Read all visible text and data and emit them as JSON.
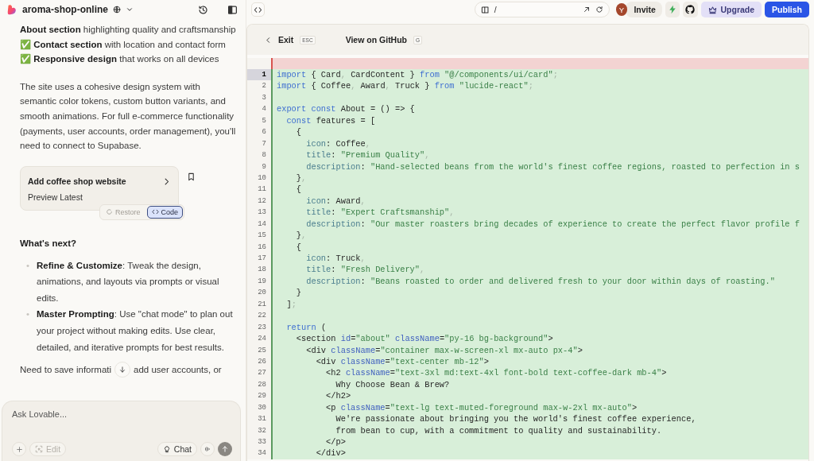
{
  "project": {
    "name": "aroma-shop-online"
  },
  "chat": {
    "paragraphs": [
      "**About section** highlighting quality and craftsmanship ✅ **Contact section** with location and contact form ✅ **Responsive design** that works on all devices",
      "The site uses a cohesive design system with semantic color tokens, custom button variants, and smooth animations. For full e-commerce functionality (payments, user accounts, order management), you'll need to connect to Supabase."
    ],
    "version_card": {
      "title": "Add coffee shop website",
      "subtitle": "Preview Latest"
    },
    "version_actions": [
      {
        "label": "Restore",
        "selected": false
      },
      {
        "label": "Code",
        "selected": true
      }
    ],
    "heading": "What's next?",
    "bullets": [
      {
        "marker": "•",
        "text": "**Refine & Customize**: Tweak the design, animations, and layouts via prompts or visual edits."
      },
      {
        "marker": "•",
        "text": "**Master Prompting**: Use \"chat mode\" to plan out your project without making edits. Use clear, detailed, and iterative prompts for best results."
      }
    ],
    "tail": [
      "Need to save informati",
      "add user accounts, or"
    ]
  },
  "composer": {
    "placeholder": "Ask Lovable...",
    "edit": {
      "label": "Edit",
      "disabled": true
    },
    "mode_label": "Chat"
  },
  "preview_bar": {
    "path": "/",
    "avatar": "Y",
    "invite": "Invite",
    "upgrade": "Upgrade",
    "publish": "Publish"
  },
  "code_view": {
    "exit": "Exit",
    "exit_key": "ESC",
    "github": "View on GitHub",
    "github_key": "G",
    "lines": [
      {
        "kind": "removed",
        "selected": false
      },
      {
        "kind": "added",
        "number": "1",
        "selected": true,
        "tokens": [
          {
            "kind": "kw",
            "text": "import"
          },
          {
            "kind": "id",
            "text": " { Card"
          },
          {
            "kind": "p",
            "text": ","
          },
          {
            "kind": "id",
            "text": " CardContent } "
          },
          {
            "kind": "kw",
            "text": "from"
          },
          {
            "kind": "str",
            "text": " \"@/components/ui/card\""
          },
          {
            "kind": "p",
            "text": ";"
          }
        ]
      },
      {
        "kind": "added",
        "number": "2",
        "selected": false,
        "tokens": [
          {
            "kind": "kw",
            "text": "import"
          },
          {
            "kind": "id",
            "text": " { Coffee"
          },
          {
            "kind": "p",
            "text": ","
          },
          {
            "kind": "id",
            "text": " Award"
          },
          {
            "kind": "p",
            "text": ","
          },
          {
            "kind": "id",
            "text": " Truck } "
          },
          {
            "kind": "kw",
            "text": "from"
          },
          {
            "kind": "str",
            "text": " \"lucide-react\""
          },
          {
            "kind": "p",
            "text": ";"
          }
        ]
      },
      {
        "kind": "added",
        "number": "3",
        "selected": false
      },
      {
        "kind": "added",
        "number": "4",
        "selected": false,
        "tokens": [
          {
            "kind": "kw",
            "text": "export const"
          },
          {
            "kind": "id",
            "text": " About = () => {"
          }
        ]
      },
      {
        "kind": "added",
        "number": "5",
        "selected": false,
        "tokens": [
          {
            "kind": "kw",
            "text": "  const"
          },
          {
            "kind": "id",
            "text": " features = ["
          }
        ]
      },
      {
        "kind": "added",
        "number": "6",
        "selected": false,
        "tokens": [
          {
            "kind": "id",
            "text": "    {"
          }
        ]
      },
      {
        "kind": "added",
        "number": "7",
        "selected": false,
        "tokens": [
          {
            "kind": "prop",
            "text": "      icon"
          },
          {
            "kind": "id",
            "text": ": Coffee"
          },
          {
            "kind": "p",
            "text": ","
          }
        ]
      },
      {
        "kind": "added",
        "number": "8",
        "selected": false,
        "tokens": [
          {
            "kind": "prop",
            "text": "      title"
          },
          {
            "kind": "id",
            "text": ": "
          },
          {
            "kind": "str",
            "text": "\"Premium Quality\""
          },
          {
            "kind": "p",
            "text": ","
          }
        ]
      },
      {
        "kind": "added",
        "number": "9",
        "selected": false,
        "tokens": [
          {
            "kind": "prop",
            "text": "      description"
          },
          {
            "kind": "id",
            "text": ": "
          },
          {
            "kind": "str",
            "text": "\"Hand-selected beans from the world's finest coffee regions, roasted to perfection in s"
          }
        ]
      },
      {
        "kind": "added",
        "number": "10",
        "selected": false,
        "tokens": [
          {
            "kind": "id",
            "text": "    }"
          },
          {
            "kind": "p",
            "text": ","
          }
        ]
      },
      {
        "kind": "added",
        "number": "11",
        "selected": false,
        "tokens": [
          {
            "kind": "id",
            "text": "    {"
          }
        ]
      },
      {
        "kind": "added",
        "number": "12",
        "selected": false,
        "tokens": [
          {
            "kind": "prop",
            "text": "      icon"
          },
          {
            "kind": "id",
            "text": ": Award"
          },
          {
            "kind": "p",
            "text": ","
          }
        ]
      },
      {
        "kind": "added",
        "number": "13",
        "selected": false,
        "tokens": [
          {
            "kind": "prop",
            "text": "      title"
          },
          {
            "kind": "id",
            "text": ": "
          },
          {
            "kind": "str",
            "text": "\"Expert Craftsmanship\""
          },
          {
            "kind": "p",
            "text": ","
          }
        ]
      },
      {
        "kind": "added",
        "number": "14",
        "selected": false,
        "tokens": [
          {
            "kind": "prop",
            "text": "      description"
          },
          {
            "kind": "id",
            "text": ": "
          },
          {
            "kind": "str",
            "text": "\"Our master roasters bring decades of experience to create the perfect flavor profile f"
          }
        ]
      },
      {
        "kind": "added",
        "number": "15",
        "selected": false,
        "tokens": [
          {
            "kind": "id",
            "text": "    }"
          },
          {
            "kind": "p",
            "text": ","
          }
        ]
      },
      {
        "kind": "added",
        "number": "16",
        "selected": false,
        "tokens": [
          {
            "kind": "id",
            "text": "    {"
          }
        ]
      },
      {
        "kind": "added",
        "number": "17",
        "selected": false,
        "tokens": [
          {
            "kind": "prop",
            "text": "      icon"
          },
          {
            "kind": "id",
            "text": ": Truck"
          },
          {
            "kind": "p",
            "text": ","
          }
        ]
      },
      {
        "kind": "added",
        "number": "18",
        "selected": false,
        "tokens": [
          {
            "kind": "prop",
            "text": "      title"
          },
          {
            "kind": "id",
            "text": ": "
          },
          {
            "kind": "str",
            "text": "\"Fresh Delivery\""
          },
          {
            "kind": "p",
            "text": ","
          }
        ]
      },
      {
        "kind": "added",
        "number": "19",
        "selected": false,
        "tokens": [
          {
            "kind": "prop",
            "text": "      description"
          },
          {
            "kind": "id",
            "text": ": "
          },
          {
            "kind": "str",
            "text": "\"Beans roasted to order and delivered fresh to your door within days of roasting.\""
          }
        ]
      },
      {
        "kind": "added",
        "number": "20",
        "selected": false,
        "tokens": [
          {
            "kind": "id",
            "text": "    }"
          }
        ]
      },
      {
        "kind": "added",
        "number": "21",
        "selected": false,
        "tokens": [
          {
            "kind": "id",
            "text": "  ]"
          },
          {
            "kind": "p",
            "text": ";"
          }
        ]
      },
      {
        "kind": "added",
        "number": "22",
        "selected": false
      },
      {
        "kind": "added",
        "number": "23",
        "selected": false,
        "tokens": [
          {
            "kind": "kw",
            "text": "  return"
          },
          {
            "kind": "id",
            "text": " ("
          }
        ]
      },
      {
        "kind": "added",
        "number": "24",
        "selected": false,
        "tokens": [
          {
            "kind": "id",
            "text": "    <section "
          },
          {
            "kind": "attr",
            "text": "id"
          },
          {
            "kind": "id",
            "text": "="
          },
          {
            "kind": "str",
            "text": "\"about\""
          },
          {
            "kind": "attr",
            "text": " className"
          },
          {
            "kind": "id",
            "text": "="
          },
          {
            "kind": "str",
            "text": "\"py-16 bg-background\""
          },
          {
            "kind": "id",
            "text": ">"
          }
        ]
      },
      {
        "kind": "added",
        "number": "25",
        "selected": false,
        "tokens": [
          {
            "kind": "id",
            "text": "      <div "
          },
          {
            "kind": "attr",
            "text": "className"
          },
          {
            "kind": "id",
            "text": "="
          },
          {
            "kind": "str",
            "text": "\"container max-w-screen-xl mx-auto px-4\""
          },
          {
            "kind": "id",
            "text": ">"
          }
        ]
      },
      {
        "kind": "added",
        "number": "26",
        "selected": false,
        "tokens": [
          {
            "kind": "id",
            "text": "        <div "
          },
          {
            "kind": "attr",
            "text": "className"
          },
          {
            "kind": "id",
            "text": "="
          },
          {
            "kind": "str",
            "text": "\"text-center mb-12\""
          },
          {
            "kind": "id",
            "text": ">"
          }
        ]
      },
      {
        "kind": "added",
        "number": "27",
        "selected": false,
        "tokens": [
          {
            "kind": "id",
            "text": "          <h2 "
          },
          {
            "kind": "attr",
            "text": "className"
          },
          {
            "kind": "id",
            "text": "="
          },
          {
            "kind": "str",
            "text": "\"text-3xl md:text-4xl font-bold text-coffee-dark mb-4\""
          },
          {
            "kind": "id",
            "text": ">"
          }
        ]
      },
      {
        "kind": "added",
        "number": "28",
        "selected": false,
        "tokens": [
          {
            "kind": "id",
            "text": "            Why Choose Bean & Brew?"
          }
        ]
      },
      {
        "kind": "added",
        "number": "29",
        "selected": false,
        "tokens": [
          {
            "kind": "id",
            "text": "          </h2>"
          }
        ]
      },
      {
        "kind": "added",
        "number": "30",
        "selected": false,
        "tokens": [
          {
            "kind": "id",
            "text": "          <p "
          },
          {
            "kind": "attr",
            "text": "className"
          },
          {
            "kind": "id",
            "text": "="
          },
          {
            "kind": "str",
            "text": "\"text-lg text-muted-foreground max-w-2xl mx-auto\""
          },
          {
            "kind": "id",
            "text": ">"
          }
        ]
      },
      {
        "kind": "added",
        "number": "31",
        "selected": false,
        "tokens": [
          {
            "kind": "id",
            "text": "            We're passionate about bringing you the world's finest coffee experience,"
          }
        ]
      },
      {
        "kind": "added",
        "number": "32",
        "selected": false,
        "tokens": [
          {
            "kind": "id",
            "text": "            from bean to cup, with a commitment to quality and sustainability."
          }
        ]
      },
      {
        "kind": "added",
        "number": "33",
        "selected": false,
        "tokens": [
          {
            "kind": "id",
            "text": "          </p>"
          }
        ]
      },
      {
        "kind": "added",
        "number": "34",
        "selected": false,
        "tokens": [
          {
            "kind": "id",
            "text": "        </div>"
          }
        ]
      }
    ]
  }
}
